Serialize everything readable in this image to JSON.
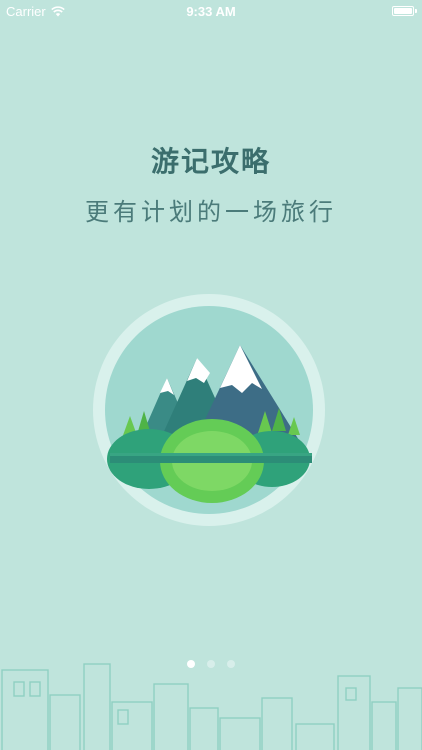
{
  "status_bar": {
    "carrier": "Carrier",
    "time": "9:33 AM"
  },
  "onboarding": {
    "title": "游记攻略",
    "subtitle": "更有计划的一场旅行",
    "page_indicator": {
      "total_pages": 3,
      "current_page": 1
    }
  },
  "icons": [
    "wifi-icon",
    "battery-icon",
    "mountain-illustration",
    "city-skyline-illustration"
  ],
  "colors": {
    "background": "#bfe4dc",
    "title_text": "#3b6e6d",
    "circle_outer": "#d9f1ec",
    "circle_inner": "#9fd8cf",
    "mountain_dark": "#2f7f7a",
    "hill_green": "#64cc56"
  }
}
